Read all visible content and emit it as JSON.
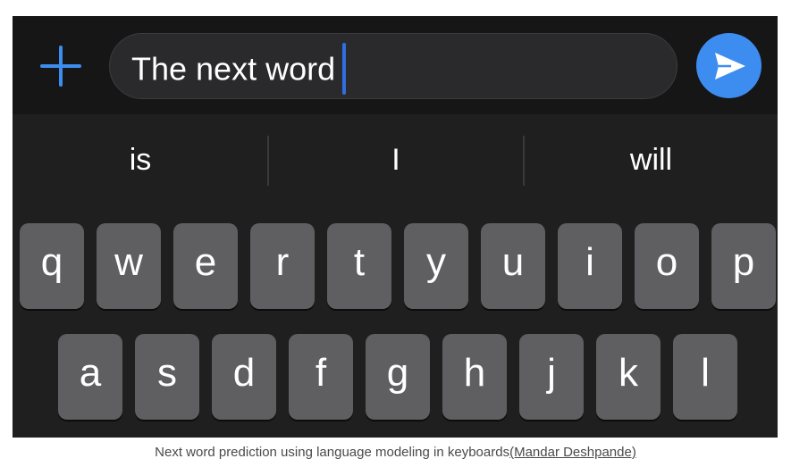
{
  "composer": {
    "text": "The next word",
    "plus_icon": "plus-icon",
    "send_icon": "send-arrow-icon",
    "accent_color": "#3d8cf0"
  },
  "suggestions": [
    "is",
    "I",
    "will"
  ],
  "keyboard": {
    "row1": [
      "q",
      "w",
      "e",
      "r",
      "t",
      "y",
      "u",
      "i",
      "o",
      "p"
    ],
    "row2": [
      "a",
      "s",
      "d",
      "f",
      "g",
      "h",
      "j",
      "k",
      "l"
    ]
  },
  "caption": {
    "text": "Next word prediction using language modeling in keyboards",
    "link": "(Mandar Deshpande)"
  }
}
